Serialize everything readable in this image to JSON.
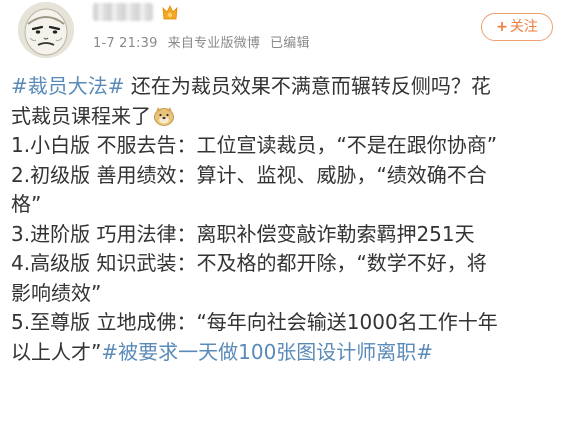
{
  "post": {
    "time": "1-7 21:39",
    "source": "来自专业版微博",
    "edited": "已编辑",
    "follow_label": "关注",
    "follow_plus": "+"
  },
  "content": {
    "line1_tag": "#裁员大法#",
    "line1_text": " 还在为裁员效果不满意而辗转反侧吗？花",
    "line2_text": "式裁员课程来了",
    "line3": "1.小白版 不服去告：工位宣读裁员，“不是在跟你协商”",
    "line4": "2.初级版 善用绩效：算计、监视、威胁，“绩效确不合",
    "line5": "格”",
    "line6": "3.进阶版 巧用法律：离职补偿变敲诈勒索羁押251天",
    "line7": "4.高级版 知识武装：不及格的都开除，“数学不好，将",
    "line8": "影响绩效”",
    "line9": "5.至尊版 立地成佛：“每年向社会输送1000名工作十年",
    "line10_text": "以上人才”",
    "line10_tag": "#被要求一天做100张图设计师离职#"
  },
  "icons": {
    "avatar": "meme-face-avatar",
    "vip": "vip-badge-icon",
    "emoji": "doge-emoji-icon"
  },
  "colors": {
    "hashtag": "#5a8ab8",
    "follow": "#f07b3c",
    "meta": "#8a8a8a",
    "text": "#333333"
  }
}
